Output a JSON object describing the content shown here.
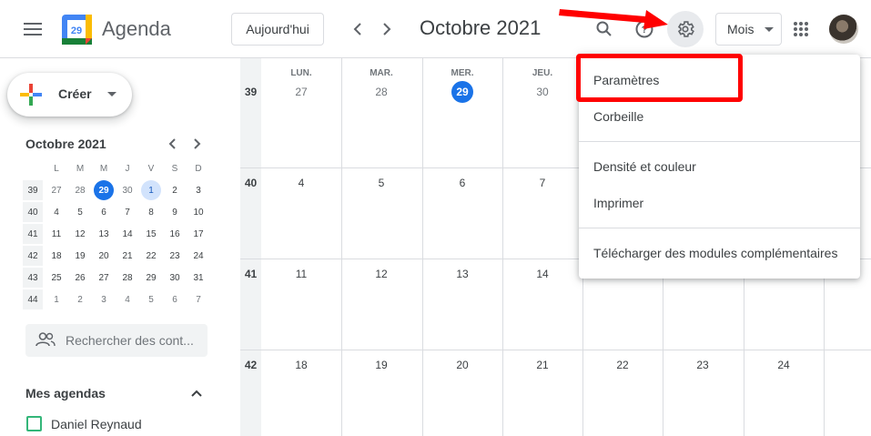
{
  "app": {
    "title": "Agenda",
    "logo_day": "29"
  },
  "header": {
    "today_label": "Aujourd'hui",
    "date_title": "Octobre 2021",
    "view_label": "Mois"
  },
  "sidebar": {
    "create_label": "Créer",
    "mini_cal": {
      "title": "Octobre 2021",
      "weekdays": [
        "L",
        "M",
        "M",
        "J",
        "V",
        "S",
        "D"
      ],
      "weeks": [
        {
          "num": "39",
          "days": [
            "27",
            "28",
            "29",
            "30",
            "1",
            "2",
            "3"
          ]
        },
        {
          "num": "40",
          "days": [
            "4",
            "5",
            "6",
            "7",
            "8",
            "9",
            "10"
          ]
        },
        {
          "num": "41",
          "days": [
            "11",
            "12",
            "13",
            "14",
            "15",
            "16",
            "17"
          ]
        },
        {
          "num": "42",
          "days": [
            "18",
            "19",
            "20",
            "21",
            "22",
            "23",
            "24"
          ]
        },
        {
          "num": "43",
          "days": [
            "25",
            "26",
            "27",
            "28",
            "29",
            "30",
            "31"
          ]
        },
        {
          "num": "44",
          "days": [
            "1",
            "2",
            "3",
            "4",
            "5",
            "6",
            "7"
          ]
        }
      ]
    },
    "search_people_placeholder": "Rechercher des cont...",
    "my_calendars_title": "Mes agendas",
    "calendars": [
      {
        "name": "Daniel Reynaud",
        "color": "#33b679"
      }
    ]
  },
  "grid": {
    "day_names": [
      "LUN.",
      "MAR.",
      "MER.",
      "JEU."
    ],
    "weeks": [
      {
        "num": "39",
        "days": [
          "27",
          "28",
          "29",
          "30",
          "",
          "",
          ""
        ]
      },
      {
        "num": "40",
        "days": [
          "4",
          "5",
          "6",
          "7",
          "",
          "",
          ""
        ]
      },
      {
        "num": "41",
        "days": [
          "11",
          "12",
          "13",
          "14",
          "",
          "",
          ""
        ]
      },
      {
        "num": "42",
        "days": [
          "18",
          "19",
          "20",
          "21",
          "22",
          "23",
          "24"
        ]
      }
    ],
    "today": "29"
  },
  "settings_menu": {
    "items": [
      "Paramètres",
      "Corbeille",
      "Densité et couleur",
      "Imprimer",
      "Télécharger des modules complémentaires"
    ]
  },
  "colors": {
    "accent": "#1a73e8",
    "annotation": "#ff0000",
    "calendar": "#33b679"
  }
}
